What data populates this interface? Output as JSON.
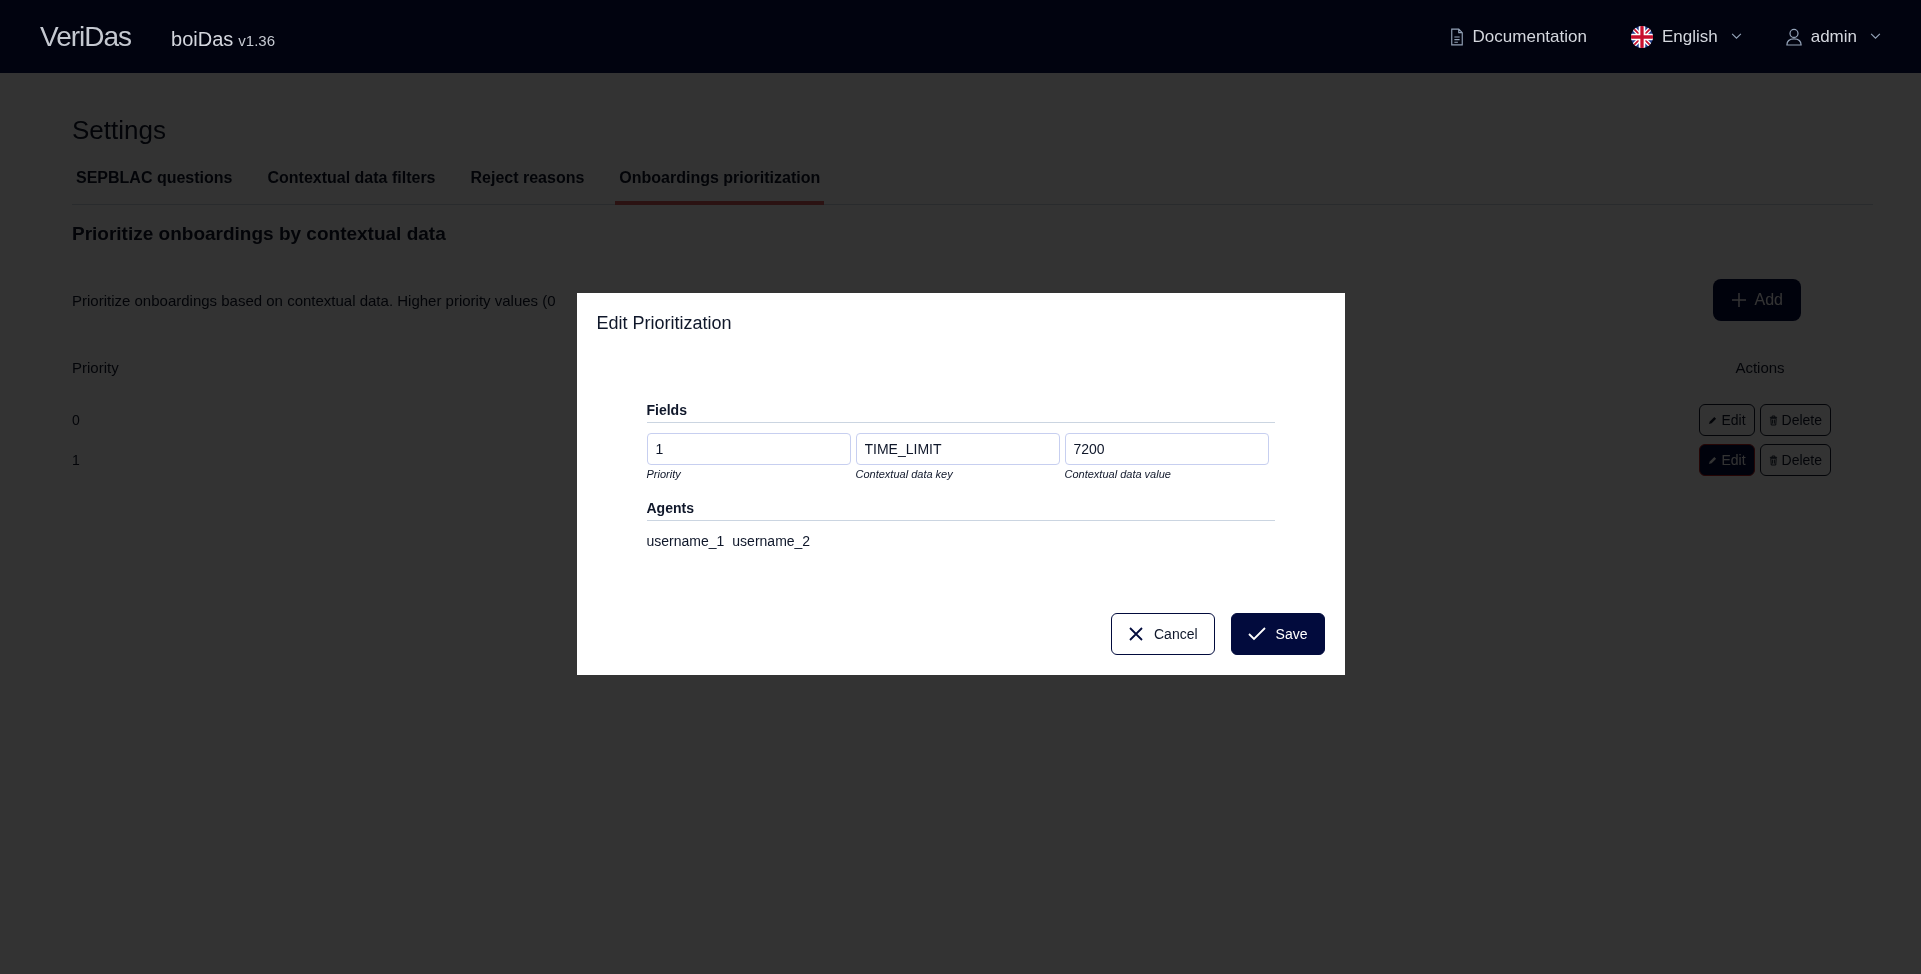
{
  "header": {
    "logo": "VeriDas",
    "product": "boiDas",
    "version": "v1.36",
    "links": [
      {
        "kind": "doc",
        "label": "Documentation"
      },
      {
        "kind": "language",
        "label": "English"
      },
      {
        "kind": "user",
        "label": "admin"
      }
    ]
  },
  "page": {
    "title": "Settings",
    "tabs": [
      {
        "label": "SEPBLAC questions",
        "selected": false
      },
      {
        "label": "Contextual data filters",
        "selected": false
      },
      {
        "label": "Reject reasons",
        "selected": false
      },
      {
        "label": "Onboardings prioritization",
        "selected": true
      }
    ],
    "section_title": "Prioritize onboardings by contextual data",
    "description": "Prioritize onboardings based on contextual data. Higher priority values (0",
    "add_button": "Add",
    "table": {
      "columns": [
        "Priority",
        "Actions"
      ],
      "rows": [
        {
          "priority": "0",
          "selected": false,
          "edit": "Edit",
          "delete": "Delete"
        },
        {
          "priority": "1",
          "selected": true,
          "edit": "Edit",
          "delete": "Delete"
        }
      ]
    }
  },
  "dialog": {
    "title": "Edit Prioritization",
    "fields_heading": "Fields",
    "fields": [
      {
        "value": "1",
        "caption": "Priority"
      },
      {
        "value": "TIME_LIMIT",
        "caption": "Contextual data key"
      },
      {
        "value": "7200",
        "caption": "Contextual data value"
      }
    ],
    "agents_heading": "Agents",
    "agents": [
      "username_1",
      "username_2"
    ],
    "buttons": [
      {
        "kind": "cancel",
        "label": "Cancel"
      },
      {
        "kind": "save",
        "label": "Save"
      }
    ]
  }
}
